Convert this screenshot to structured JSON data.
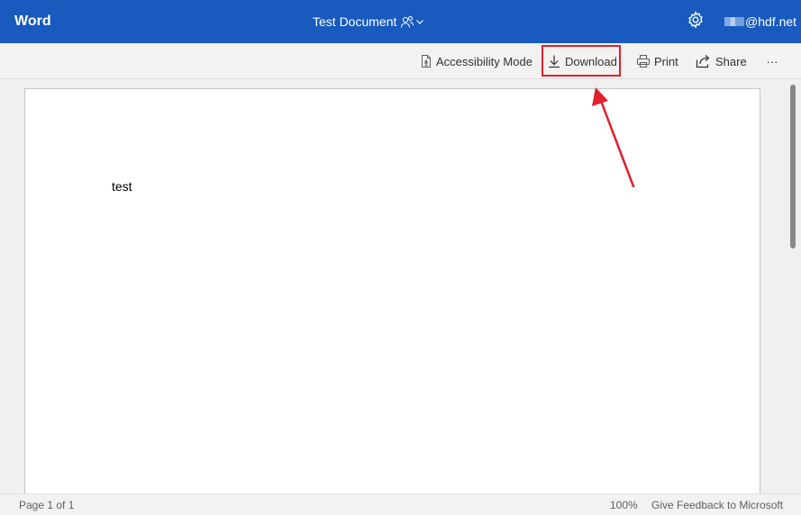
{
  "titlebar": {
    "app_name": "Word",
    "document_title": "Test Document",
    "account_suffix": "@hdf.net",
    "icons": [
      "people-icon",
      "chevron-down-icon",
      "gear-icon"
    ],
    "background": "#185abd"
  },
  "commandbar": {
    "accessibility_label": "Accessibility Mode",
    "download_label": "Download",
    "print_label": "Print",
    "share_label": "Share",
    "more_label": "···",
    "highlight_color": "#e0202a"
  },
  "document": {
    "body_text": "test"
  },
  "statusbar": {
    "page_info": "Page 1 of 1",
    "zoom": "100%",
    "feedback": "Give Feedback to Microsoft"
  }
}
